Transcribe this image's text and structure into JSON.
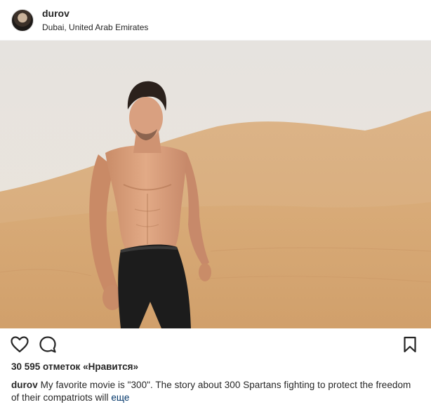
{
  "post": {
    "username": "durov",
    "location": "Dubai, United Arab Emirates",
    "likes": "30 595 отметок «Нравится»",
    "caption_user": "durov",
    "caption_text": "My favorite movie is \"300\". The story about 300 Spartans fighting to protect the freedom of their compatriots will",
    "more_label": "еще"
  },
  "icons": {
    "avatar": "profile-avatar",
    "like": "heart-icon",
    "comment": "comment-icon",
    "save": "bookmark-icon"
  },
  "colors": {
    "text": "#262626",
    "link": "#003569",
    "border": "#efefef",
    "sky": "#e9e5e0",
    "sand": "#d8aa78"
  }
}
